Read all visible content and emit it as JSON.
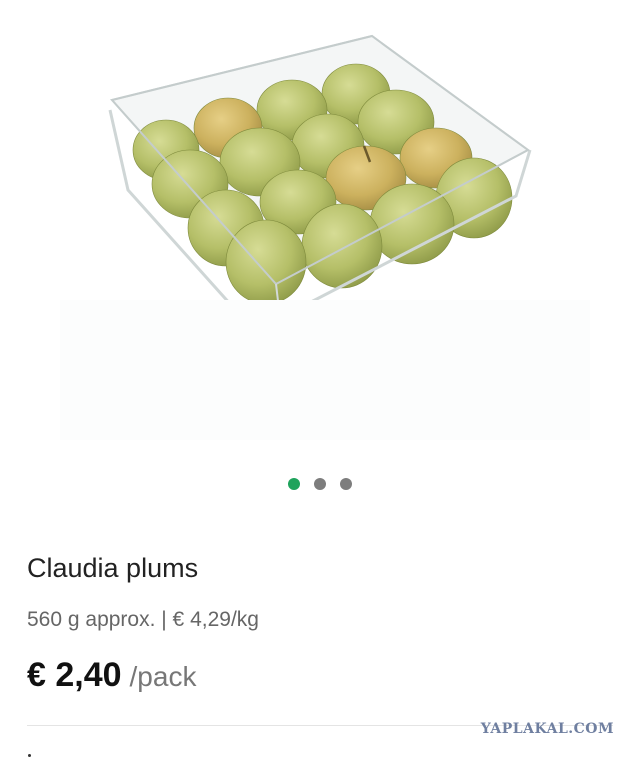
{
  "gallery": {
    "image": "product-photo",
    "slides": 3,
    "active_slide": 1,
    "colors": {
      "active_dot": "#1fa35c",
      "inactive_dot": "#7d7d7d"
    }
  },
  "product": {
    "name": "Claudia plums",
    "weight_price": "560 g approx. | € 4,29/kg",
    "price": "€ 2,40",
    "price_unit": "/pack"
  },
  "watermark": "YAPLAKAL.COM"
}
